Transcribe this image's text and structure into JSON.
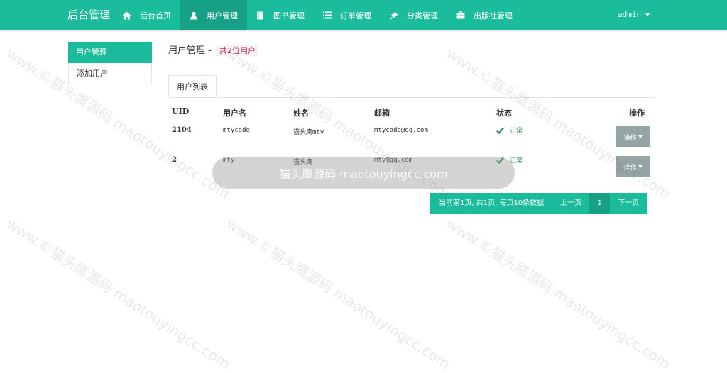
{
  "nav": {
    "brand": "后台管理",
    "items": [
      {
        "label": "后台首页",
        "icon": "home-icon"
      },
      {
        "label": "用户管理",
        "icon": "user-icon"
      },
      {
        "label": "图书管理",
        "icon": "book-icon"
      },
      {
        "label": "订单管理",
        "icon": "list-icon"
      },
      {
        "label": "分类管理",
        "icon": "pushpin-icon"
      },
      {
        "label": "出版社管理",
        "icon": "briefcase-icon"
      }
    ],
    "user": "admin"
  },
  "sidebar": {
    "items": [
      {
        "label": "用户管理"
      },
      {
        "label": "添加用户"
      }
    ]
  },
  "main": {
    "title": "用户管理 -",
    "count": "共2位用户",
    "tab": "用户列表",
    "columns": [
      "UID",
      "用户名",
      "姓名",
      "邮箱",
      "状态",
      "操作"
    ],
    "rows": [
      {
        "uid": "2104",
        "username": "mtycode",
        "name": "猫头鹰mty",
        "email": "mtycode@qq.com",
        "status": "正常",
        "action": "操作"
      },
      {
        "uid": "2",
        "username": "mty",
        "name": "猫头鹰",
        "email": "mty@qq.com",
        "status": "正常",
        "action": "操作"
      }
    ],
    "pagination": {
      "info": "当前第1页, 共1页, 每页10条数据",
      "prev": "上一页",
      "current": "1",
      "next": "下一页"
    }
  },
  "watermark": {
    "text": "www.©猫头鹰源码 maotouyingcc.com",
    "banner": "猫头鹰源码 maotouyingcc.com"
  },
  "colors": {
    "primary": "#1abc9c",
    "primary_dark": "#16a085",
    "button_gray": "#95a5a6",
    "status_green": "#2e8b57",
    "count_red": "#c7254e"
  }
}
